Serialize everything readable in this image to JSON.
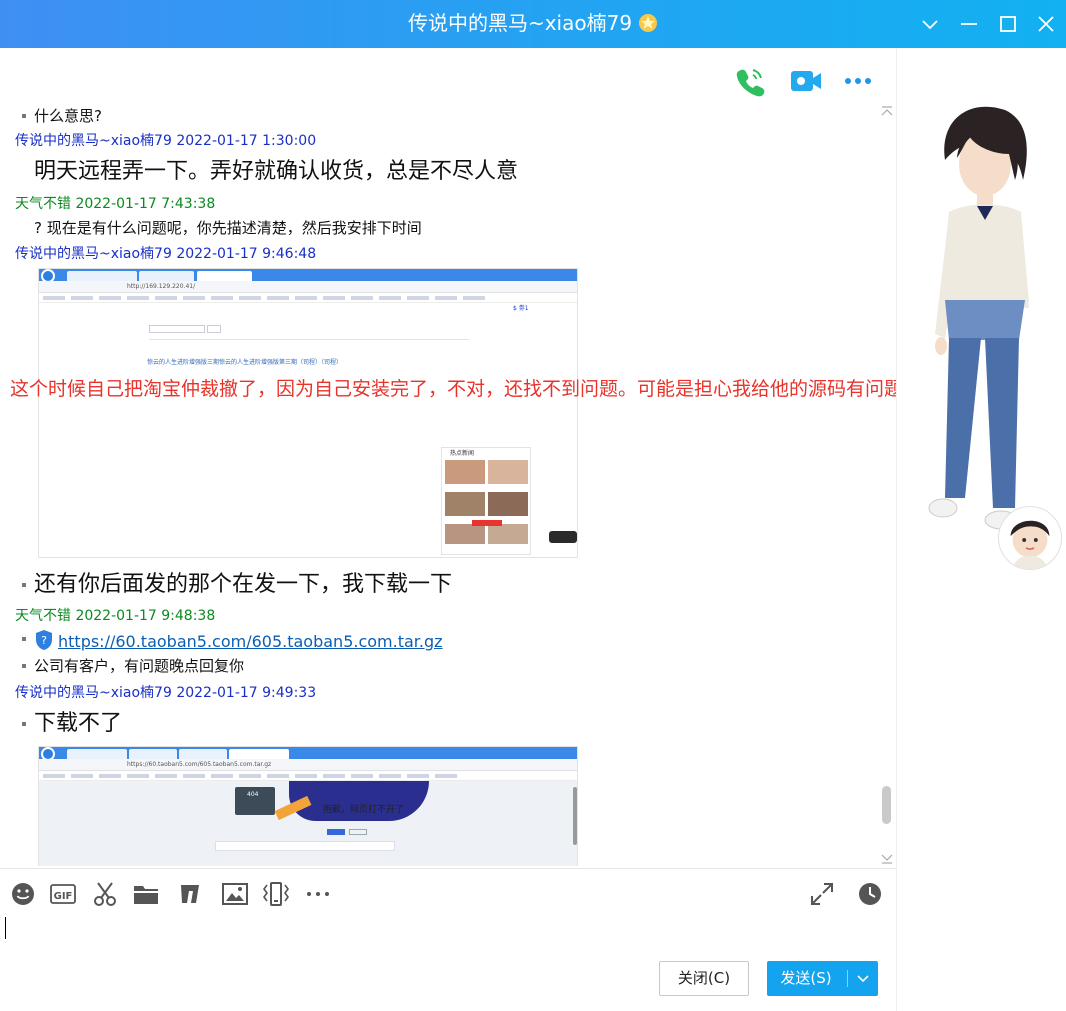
{
  "window": {
    "title": "传说中的黑马~xiao楠79",
    "accent": "#22a4f2"
  },
  "header_icons": [
    "phone-icon",
    "video-call-icon",
    "more-icon"
  ],
  "messages": [
    {
      "type": "text",
      "text": "什么意思?"
    },
    {
      "type": "sender",
      "name": "传说中的黑马~xiao楠79",
      "time": "2022-01-17 1:30:00"
    },
    {
      "type": "text",
      "text": "明天远程弄一下。弄好就确认收货，总是不尽人意"
    },
    {
      "type": "sender",
      "name": "天气不错",
      "time": "2022-01-17 7:43:38"
    },
    {
      "type": "text",
      "text": "? 现在是有什么问题呢，你先描述清楚，然后我安排下时间"
    },
    {
      "type": "sender",
      "name": "传说中的黑马~xiao楠79",
      "time": "2022-01-17 9:46:48"
    },
    {
      "type": "text",
      "text": "还有你后面发的那个在发一下，我下载一下"
    },
    {
      "type": "sender",
      "name": "天气不错",
      "time": "2022-01-17 9:48:38"
    },
    {
      "type": "link",
      "text": "https://60.taoban5.com/605.taoban5.com.tar.gz"
    },
    {
      "type": "text",
      "text": "公司有客户，有问题晚点回复你"
    },
    {
      "type": "sender",
      "name": "传说中的黑马~xiao楠79",
      "time": "2022-01-17 9:49:33"
    },
    {
      "type": "text",
      "text": "下载不了"
    }
  ],
  "screenshot1": {
    "url": "http://169.129.220.41/",
    "counter": "$ 劵1",
    "line": "惊云的人生进阶增强版三期惊云的人生进阶增强版第三期（司程）（司程）",
    "news_title": "热点新闻"
  },
  "screenshot2": {
    "url": "https://60.taoban5.com/605.taoban5.com.tar.gz",
    "error": "抱歉，网页打不开了",
    "code": "404"
  },
  "annotation": "这个时候自己把淘宝仲裁撤了，因为自己安装完了，不对，还找不到问题。可能是担心我给他的源码有问题。",
  "toolbar_icons": [
    "emoji-icon",
    "gif-icon",
    "scissors-icon",
    "folder-icon",
    "music-icon",
    "image-icon",
    "vibrate-icon",
    "more-icon",
    "expand-icon",
    "history-icon"
  ],
  "buttons": {
    "close": "关闭(C)",
    "send": "发送(S)"
  }
}
